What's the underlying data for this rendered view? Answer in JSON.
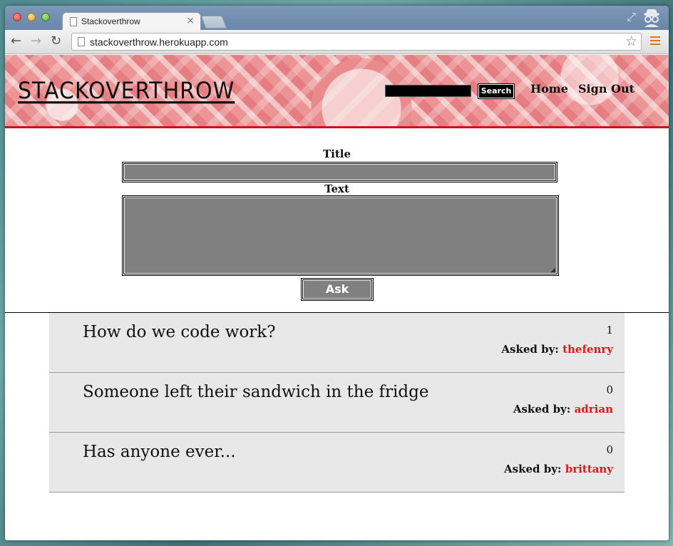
{
  "browser": {
    "tab_title": "Stackoverthrow",
    "tab_close": "×",
    "url": "stackoverthrow.herokuapp.com"
  },
  "header": {
    "logo": "STACKOVERTHROW",
    "search_button": "Search",
    "nav": {
      "home": "Home",
      "sign_out": "Sign Out"
    }
  },
  "form": {
    "title_label": "Title",
    "title_value": "",
    "text_label": "Text",
    "text_value": "",
    "ask_button": "Ask"
  },
  "questions": [
    {
      "title": "How do we code work?",
      "count": "1",
      "asked_by_label": "Asked by:",
      "user": "thefenry"
    },
    {
      "title": "Someone left their sandwich in the fridge",
      "count": "0",
      "asked_by_label": "Asked by:",
      "user": "adrian"
    },
    {
      "title": "Has anyone ever...",
      "count": "0",
      "asked_by_label": "Asked by:",
      "user": "brittany"
    }
  ],
  "colors": {
    "accent_red": "#e4161c",
    "header_border": "#c4171a",
    "input_gray": "#808080",
    "list_bg": "#e8e8e8"
  }
}
